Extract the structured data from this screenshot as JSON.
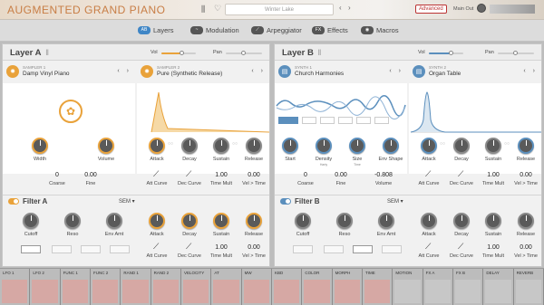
{
  "header": {
    "app_title": "AUGMENTED GRAND PIANO",
    "preset_name": "Winter Lake",
    "advanced_label": "Advanced",
    "main_out_label": "Main Out",
    "library_icon": "library-icon",
    "favorite_icon": "heart-icon"
  },
  "tabs": [
    {
      "label": "Layers",
      "icon": "AB"
    },
    {
      "label": "Modulation",
      "icon": "~"
    },
    {
      "label": "Arpeggiator",
      "icon": "⟋"
    },
    {
      "label": "Effects",
      "icon": "FX"
    },
    {
      "label": "Macros",
      "icon": "◉"
    }
  ],
  "layer_a": {
    "title": "Layer A",
    "vol_label": "Vol",
    "pan_label": "Pan",
    "engine1": {
      "type": "SAMPLER 1",
      "name": "Damp Vinyl Piano"
    },
    "engine2": {
      "type": "SAMPLER 2",
      "name": "Pure (Synthetic Release)"
    },
    "knobs1": [
      {
        "label": "Width"
      },
      {
        "label": "Volume"
      }
    ],
    "values1": [
      {
        "value": "0",
        "label": "Coarse"
      },
      {
        "value": "0.00",
        "label": "Fine"
      }
    ],
    "knobs2": [
      {
        "label": "Attack"
      },
      {
        "label": "Decay"
      },
      {
        "label": "Sustain"
      },
      {
        "label": "Release"
      }
    ],
    "values2": [
      {
        "label": "Att Curve"
      },
      {
        "label": "Dec Curve"
      },
      {
        "value": "1.00",
        "label": "Time Mult"
      },
      {
        "value": "0.00",
        "label": "Vel > Time"
      }
    ],
    "filter": {
      "title": "Filter A",
      "sem": "SEM",
      "knobs": [
        {
          "label": "Cutoff"
        },
        {
          "label": "Reso"
        },
        {
          "label": "Env Amt"
        }
      ],
      "env_knobs": [
        {
          "label": "Attack"
        },
        {
          "label": "Decay"
        },
        {
          "label": "Sustain"
        },
        {
          "label": "Release"
        }
      ],
      "env_values": [
        {
          "label": "Att Curve"
        },
        {
          "label": "Dec Curve"
        },
        {
          "value": "1.00",
          "label": "Time Mult"
        },
        {
          "value": "0.00",
          "label": "Vel > Time"
        }
      ]
    }
  },
  "layer_b": {
    "title": "Layer B",
    "vol_label": "Vol",
    "pan_label": "Pan",
    "engine1": {
      "type": "SYNTH 1",
      "name": "Church Harmonies"
    },
    "engine2": {
      "type": "SYNTH 2",
      "name": "Organ Table"
    },
    "knobs1": [
      {
        "label": "Start"
      },
      {
        "label": "Density",
        "sub": "Harty"
      },
      {
        "label": "Size",
        "sub": "Time"
      },
      {
        "label": "Env Shape"
      }
    ],
    "values1": [
      {
        "value": "0",
        "label": "Coarse"
      },
      {
        "value": "0.00",
        "label": "Fine"
      },
      {
        "value": "-0.808",
        "label": "Volume"
      }
    ],
    "knobs2": [
      {
        "label": "Attack"
      },
      {
        "label": "Decay"
      },
      {
        "label": "Sustain"
      },
      {
        "label": "Release"
      }
    ],
    "values2": [
      {
        "label": "Att Curve"
      },
      {
        "label": "Dec Curve"
      },
      {
        "value": "1.00",
        "label": "Time Mult"
      },
      {
        "value": "0.00",
        "label": "Vel > Time"
      }
    ],
    "filter": {
      "title": "Filter B",
      "sem": "SEM",
      "knobs": [
        {
          "label": "Cutoff"
        },
        {
          "label": "Reso"
        },
        {
          "label": "Env Amt"
        }
      ],
      "env_knobs": [
        {
          "label": "Attack"
        },
        {
          "label": "Decay"
        },
        {
          "label": "Sustain"
        },
        {
          "label": "Release"
        }
      ],
      "env_values": [
        {
          "label": "Att Curve"
        },
        {
          "label": "Dec Curve"
        },
        {
          "value": "1.00",
          "label": "Time Mult"
        },
        {
          "value": "0.00",
          "label": "Vel > Time"
        }
      ]
    }
  },
  "mod_slots": [
    "LFO 1",
    "LFO 2",
    "FUNC 1",
    "FUNC 2",
    "RAND 1",
    "RAND 2",
    "VELOCITY",
    "AT",
    "MW",
    "KBD",
    "COLOR",
    "MORPH",
    "TIME",
    "MOTION",
    "FX A",
    "FX B",
    "DELAY",
    "REVERB"
  ],
  "colors": {
    "accent_orange": "#e9a23a",
    "accent_blue": "#5b8fbd",
    "advanced_red": "#b33333"
  }
}
